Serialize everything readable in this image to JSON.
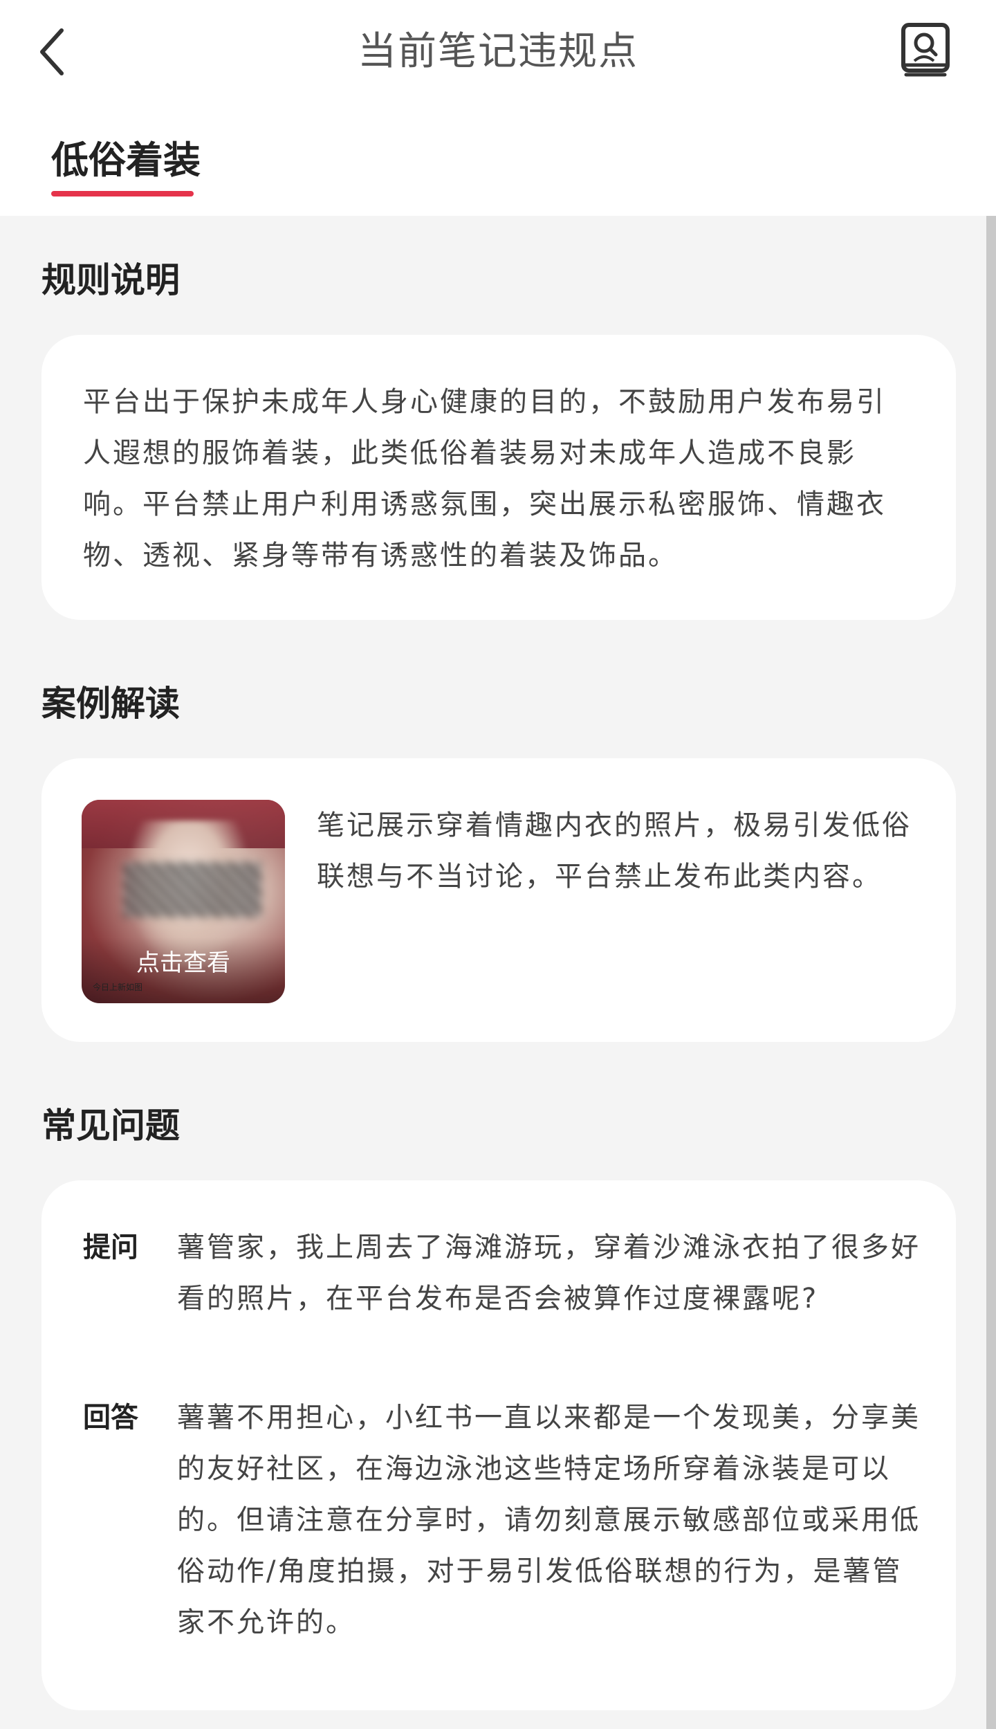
{
  "header": {
    "title": "当前笔记违规点",
    "back_icon": "chevron-left-icon",
    "guide_icon": "search-book-icon"
  },
  "tabs": [
    {
      "label": "低俗着装",
      "active": true
    }
  ],
  "rules": {
    "title": "规则说明",
    "text": "平台出于保护未成年人身心健康的目的，不鼓励用户发布易引人遐想的服饰着装，此类低俗着装易对未成年人造成不良影响。平台禁止用户利用诱惑氛围，突出展示私密服饰、情趣衣物、透视、紧身等带有诱惑性的着装及饰品。"
  },
  "case": {
    "title": "案例解读",
    "thumb_label": "点击查看",
    "thumb_caption": "今日上新如图",
    "text": "笔记展示穿着情趣内衣的照片，极易引发低俗联想与不当讨论，平台禁止发布此类内容。"
  },
  "faq": {
    "title": "常见问题",
    "question_tag": "提问",
    "question": "薯管家，我上周去了海滩游玩，穿着沙滩泳衣拍了很多好看的照片，在平台发布是否会被算作过度裸露呢?",
    "answer_tag": "回答",
    "answer": "薯薯不用担心，小红书一直以来都是一个发现美，分享美的友好社区，在海边泳池这些特定场所穿着泳装是可以的。但请注意在分享时，请勿刻意展示敏感部位或采用低俗动作/角度拍摄，对于易引发低俗联想的行为，是薯管家不允许的。"
  },
  "colors": {
    "accent": "#e5334b",
    "background": "#f4f4f4",
    "card": "#ffffff"
  }
}
